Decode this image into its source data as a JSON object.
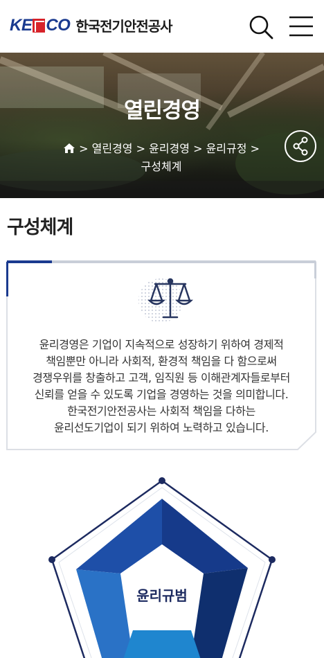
{
  "header": {
    "logo_en": "KE CO",
    "logo_ko": "한국전기안전공사",
    "search_icon": "search-icon",
    "menu_icon": "hamburger-menu-icon"
  },
  "hero": {
    "title": "열린경영",
    "breadcrumb": [
      "열린경영",
      "윤리경영",
      "윤리규정",
      "구성체계"
    ],
    "share_icon": "share-icon"
  },
  "page": {
    "title": "구성체계"
  },
  "info": {
    "icon": "scale-icon",
    "lines": [
      "윤리경영은 기업이 지속적으로 성장하기 위하여 경제적",
      "책임뿐만 아니라 사회적, 환경적 책임을 다 함으로써",
      "경쟁우위를 창출하고 고객, 임직원 등 이해관계자들로부터",
      "신뢰를 얻을 수 있도록 기업을 경영하는 것을 의미합니다.",
      "한국전기안전공사는 사회적 책임을 다하는",
      "윤리선도기업이 되기 위하여 노력하고 있습니다."
    ]
  },
  "diagram": {
    "center_label": "윤리규범"
  },
  "colors": {
    "brand_blue": "#1a3a8f",
    "brand_red": "#d7232a",
    "accent_navy": "#1c2a60"
  }
}
